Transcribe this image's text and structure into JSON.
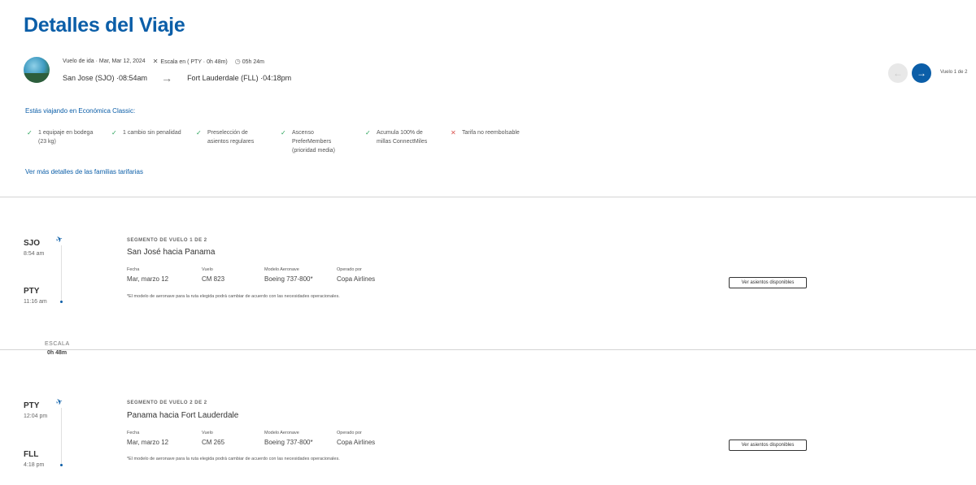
{
  "page": {
    "title": "Detalles del Viaje"
  },
  "summary": {
    "leg_label": "Vuelo de ida · Mar, Mar 12, 2024",
    "stop_info": "Escala en ( PTY · 0h 48m)",
    "duration": "05h 24m",
    "origin": "San Jose (SJO) · ",
    "origin_time": "08:54am",
    "destination": "Fort Lauderdale (FLL) · ",
    "destination_time": "04:18pm",
    "counter": "Vuelo 1 de 2"
  },
  "fare": {
    "title": "Estás viajando en Económica Classic:",
    "benefits": [
      {
        "text": "1 equipaje en bodega\n(23 kg)",
        "included": true
      },
      {
        "text": "1 cambio sin penalidad",
        "included": true
      },
      {
        "text": "Preselección de\nasientos regulares",
        "included": true
      },
      {
        "text": "Ascenso\nPreferMembers\n(prioridad media)",
        "included": true
      },
      {
        "text": "Acumula 100% de\nmillas ConnectMiles",
        "included": true
      },
      {
        "text": "Tarifa no reembolsable",
        "included": false
      }
    ],
    "more_link": "Ver más detalles de las familias tarifarias"
  },
  "segments": [
    {
      "from_code": "SJO",
      "from_time": "8:54 am",
      "to_code": "PTY",
      "to_time": "11:16 am",
      "label": "SEGMENTO DE VUELO 1 DE 2",
      "title": "San José hacia Panama",
      "date_h": "Fecha",
      "date": "Mar, marzo 12",
      "flight_h": "Vuelo",
      "flight": "CM 823",
      "aircraft_h": "Modelo Aeronave",
      "aircraft": "Boeing 737-800*",
      "operator_h": "Operado por",
      "operator": "Copa Airlines",
      "note": "*El modelo de aeronave para la ruta elegida podrá cambiar de acuerdo con las necesidades operacionales.",
      "seats_button": "Ver asientos disponibles"
    },
    {
      "from_code": "PTY",
      "from_time": "12:04 pm",
      "to_code": "FLL",
      "to_time": "4:18 pm",
      "label": "SEGMENTO DE VUELO 2 DE 2",
      "title": "Panama hacia Fort Lauderdale",
      "date_h": "Fecha",
      "date": "Mar, marzo 12",
      "flight_h": "Vuelo",
      "flight": "CM 265",
      "aircraft_h": "Modelo Aeronave",
      "aircraft": "Boeing 737-800*",
      "operator_h": "Operado por",
      "operator": "Copa Airlines",
      "note": "*El modelo de aeronave para la ruta elegida podrá cambiar de acuerdo con las necesidades operacionales.",
      "seats_button": "Ver asientos disponibles"
    }
  ],
  "layover": {
    "label": "ESCALA",
    "time": "0h 48m"
  },
  "icons": {
    "close": "close-icon",
    "clock": "clock-icon",
    "arrow_right": "arrow-right-icon",
    "arrow_left": "arrow-left-icon",
    "check": "check-icon",
    "plane": "airplane-icon"
  },
  "colors": {
    "brand_blue": "#0b5ea8",
    "check_green": "#2aa35a",
    "cross_red": "#d9534f"
  }
}
